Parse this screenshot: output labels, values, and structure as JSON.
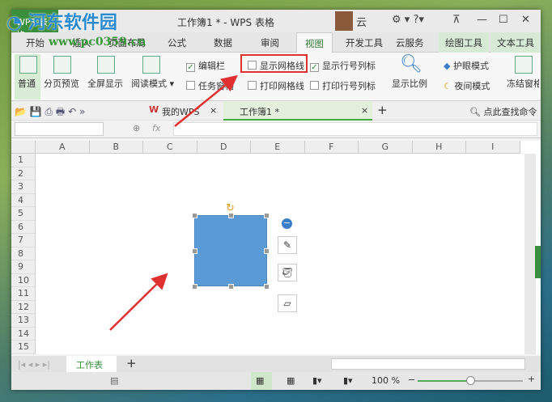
{
  "watermark": {
    "name": "河东软件园",
    "url": "www.pc0359.cn"
  },
  "titlebar": {
    "app": "WPS 表格",
    "title": "工作簿1 * - WPS 表格",
    "user": "云"
  },
  "ribbon_tabs": [
    "开始",
    "插入",
    "页面布局",
    "公式",
    "数据",
    "审阅",
    "视图",
    "开发工具",
    "云服务",
    "绘图工具",
    "文本工具"
  ],
  "active_tab": "视图",
  "ribbon": {
    "views": [
      "普通",
      "分页预览",
      "全屏显示",
      "阅读模式"
    ],
    "checks": [
      {
        "label": "编辑栏",
        "checked": true
      },
      {
        "label": "任务窗格",
        "checked": false
      },
      {
        "label": "显示网格线",
        "checked": false
      },
      {
        "label": "打印网格线",
        "checked": false
      },
      {
        "label": "显示行号列标",
        "checked": true
      },
      {
        "label": "打印行号列标",
        "checked": false
      }
    ],
    "zoom": "显示比例",
    "eye": "护眼模式",
    "night": "夜间模式",
    "freeze": "冻结窗格"
  },
  "doc_tabs": [
    {
      "label": "我的WPS"
    },
    {
      "label": "工作簿1 *"
    }
  ],
  "search_cmd": "点此查找命令",
  "formula": {
    "fx": "fx"
  },
  "columns": [
    "A",
    "B",
    "C",
    "D",
    "E",
    "F",
    "G",
    "H",
    "I"
  ],
  "rows": [
    "1",
    "2",
    "3",
    "4",
    "5",
    "6",
    "7",
    "8",
    "9",
    "10",
    "11",
    "12",
    "13",
    "14",
    "15"
  ],
  "sheet": "工作表1",
  "status": {
    "zoom": "100 %",
    "zoom_fraction": 0.5
  },
  "colors": {
    "shape": "#5b9bd5",
    "highlight": "#e03030",
    "accent": "#2f7b33"
  }
}
